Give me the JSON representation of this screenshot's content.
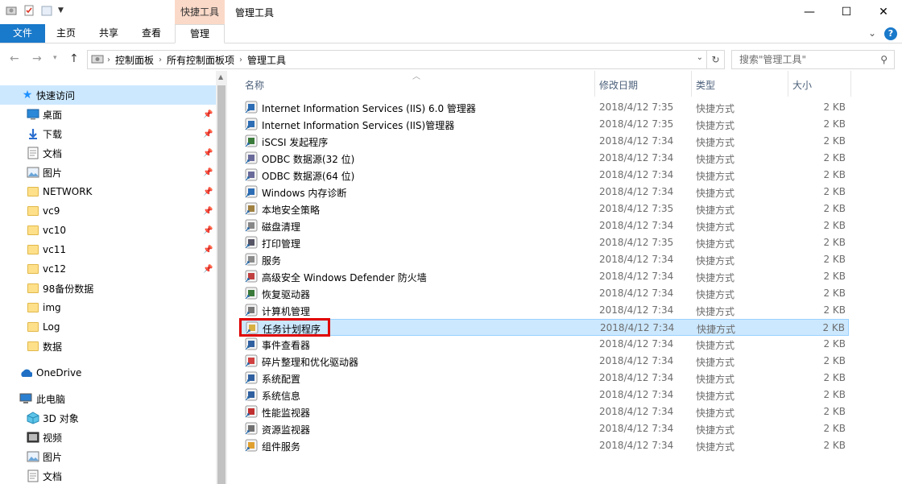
{
  "window": {
    "contextual_tab": "快捷工具",
    "title": "管理工具",
    "minimize": "—",
    "maximize": "☐",
    "close": "✕"
  },
  "ribbon": {
    "tabs": [
      {
        "label": "文件"
      },
      {
        "label": "主页"
      },
      {
        "label": "共享"
      },
      {
        "label": "查看"
      },
      {
        "label": "管理"
      }
    ],
    "collapse": "⌄",
    "help": "?"
  },
  "address": {
    "crumbs": [
      "控制面板",
      "所有控制面板项",
      "管理工具"
    ],
    "search_placeholder": "搜索\"管理工具\""
  },
  "nav": {
    "quick_access": "快速访问",
    "items": [
      {
        "label": "桌面",
        "icon": "desktop-icon",
        "pinned": true
      },
      {
        "label": "下载",
        "icon": "download-icon",
        "pinned": true
      },
      {
        "label": "文档",
        "icon": "documents-icon",
        "pinned": true
      },
      {
        "label": "图片",
        "icon": "pictures-icon",
        "pinned": true
      },
      {
        "label": "NETWORK",
        "icon": "folder-icon",
        "pinned": true
      },
      {
        "label": "vc9",
        "icon": "folder-icon",
        "pinned": true
      },
      {
        "label": "vc10",
        "icon": "folder-icon",
        "pinned": true
      },
      {
        "label": "vc11",
        "icon": "folder-icon",
        "pinned": true
      },
      {
        "label": "vc12",
        "icon": "folder-icon",
        "pinned": true
      },
      {
        "label": "98备份数据",
        "icon": "folder-icon",
        "pinned": false
      },
      {
        "label": "img",
        "icon": "folder-icon",
        "pinned": false
      },
      {
        "label": "Log",
        "icon": "folder-icon",
        "pinned": false
      },
      {
        "label": "数据",
        "icon": "folder-icon",
        "pinned": false
      }
    ],
    "onedrive": "OneDrive",
    "this_pc": "此电脑",
    "pc_items": [
      {
        "label": "3D 对象",
        "icon": "3d-objects-icon"
      },
      {
        "label": "视频",
        "icon": "videos-icon"
      },
      {
        "label": "图片",
        "icon": "pictures-icon"
      },
      {
        "label": "文档",
        "icon": "documents-icon"
      }
    ]
  },
  "columns": {
    "name": "名称",
    "date": "修改日期",
    "type": "类型",
    "size": "大小"
  },
  "files": [
    {
      "name": "Internet Information Services (IIS) 6.0 管理器",
      "date": "2018/4/12 7:35",
      "type": "快捷方式",
      "size": "2 KB"
    },
    {
      "name": "Internet Information Services (IIS)管理器",
      "date": "2018/4/12 7:35",
      "type": "快捷方式",
      "size": "2 KB"
    },
    {
      "name": "iSCSI 发起程序",
      "date": "2018/4/12 7:34",
      "type": "快捷方式",
      "size": "2 KB"
    },
    {
      "name": "ODBC 数据源(32 位)",
      "date": "2018/4/12 7:34",
      "type": "快捷方式",
      "size": "2 KB"
    },
    {
      "name": "ODBC 数据源(64 位)",
      "date": "2018/4/12 7:34",
      "type": "快捷方式",
      "size": "2 KB"
    },
    {
      "name": "Windows 内存诊断",
      "date": "2018/4/12 7:34",
      "type": "快捷方式",
      "size": "2 KB"
    },
    {
      "name": "本地安全策略",
      "date": "2018/4/12 7:35",
      "type": "快捷方式",
      "size": "2 KB"
    },
    {
      "name": "磁盘清理",
      "date": "2018/4/12 7:34",
      "type": "快捷方式",
      "size": "2 KB"
    },
    {
      "name": "打印管理",
      "date": "2018/4/12 7:35",
      "type": "快捷方式",
      "size": "2 KB"
    },
    {
      "name": "服务",
      "date": "2018/4/12 7:34",
      "type": "快捷方式",
      "size": "2 KB"
    },
    {
      "name": "高级安全 Windows Defender 防火墙",
      "date": "2018/4/12 7:34",
      "type": "快捷方式",
      "size": "2 KB"
    },
    {
      "name": "恢复驱动器",
      "date": "2018/4/12 7:34",
      "type": "快捷方式",
      "size": "2 KB"
    },
    {
      "name": "计算机管理",
      "date": "2018/4/12 7:34",
      "type": "快捷方式",
      "size": "2 KB"
    },
    {
      "name": "任务计划程序",
      "date": "2018/4/12 7:34",
      "type": "快捷方式",
      "size": "2 KB",
      "selected": true
    },
    {
      "name": "事件查看器",
      "date": "2018/4/12 7:34",
      "type": "快捷方式",
      "size": "2 KB"
    },
    {
      "name": "碎片整理和优化驱动器",
      "date": "2018/4/12 7:34",
      "type": "快捷方式",
      "size": "2 KB"
    },
    {
      "name": "系统配置",
      "date": "2018/4/12 7:34",
      "type": "快捷方式",
      "size": "2 KB"
    },
    {
      "name": "系统信息",
      "date": "2018/4/12 7:34",
      "type": "快捷方式",
      "size": "2 KB"
    },
    {
      "name": "性能监视器",
      "date": "2018/4/12 7:34",
      "type": "快捷方式",
      "size": "2 KB"
    },
    {
      "name": "资源监视器",
      "date": "2018/4/12 7:34",
      "type": "快捷方式",
      "size": "2 KB"
    },
    {
      "name": "组件服务",
      "date": "2018/4/12 7:34",
      "type": "快捷方式",
      "size": "2 KB"
    }
  ]
}
